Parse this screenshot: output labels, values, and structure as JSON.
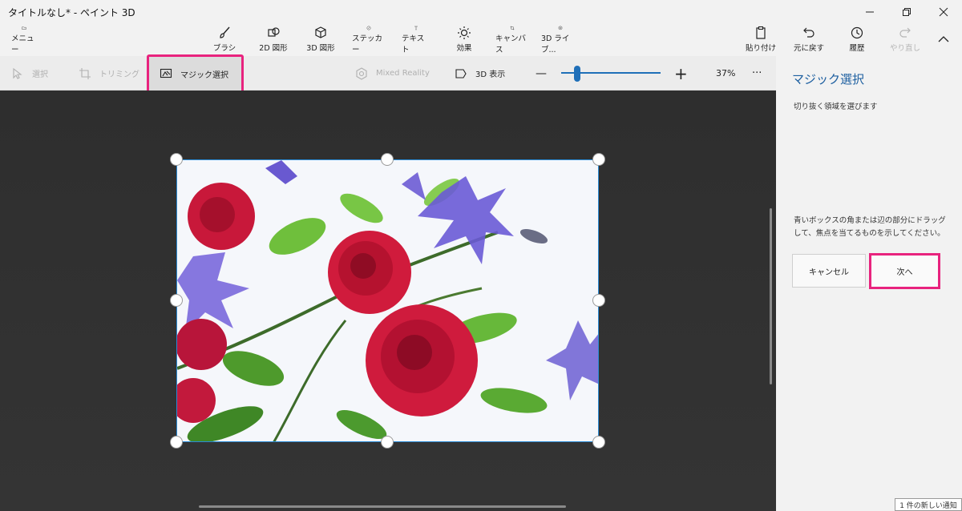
{
  "window": {
    "title": "タイトルなし* - ペイント 3D"
  },
  "ribbon": {
    "menu": "メニュー",
    "brush": "ブラシ",
    "shapes2d": "2D 図形",
    "shapes3d": "3D 図形",
    "sticker": "ステッカー",
    "text": "テキスト",
    "effects": "効果",
    "canvas": "キャンバス",
    "library3d": "3D ライブ...",
    "paste": "貼り付け",
    "undo": "元に戻す",
    "history": "履歴",
    "redo": "やり直し"
  },
  "toolbar": {
    "select": "選択",
    "crop": "トリミング",
    "magic_select": "マジック選択",
    "mixed_reality": "Mixed Reality",
    "view3d": "3D 表示",
    "zoom_minus": "—",
    "zoom_plus": "+",
    "zoom_level": "37%",
    "more": "···"
  },
  "panel": {
    "title": "マジック選択",
    "hint1": "切り抜く領域を選びます",
    "hint2": "青いボックスの角または辺の部分にドラッグして、焦点を当てるものを示してください。",
    "cancel": "キャンセル",
    "next": "次へ"
  },
  "notification": "1 件の新しい通知",
  "colors": {
    "accent": "#1f6fb8",
    "highlight": "#e8237e",
    "panel_title": "#1d5fa0"
  }
}
